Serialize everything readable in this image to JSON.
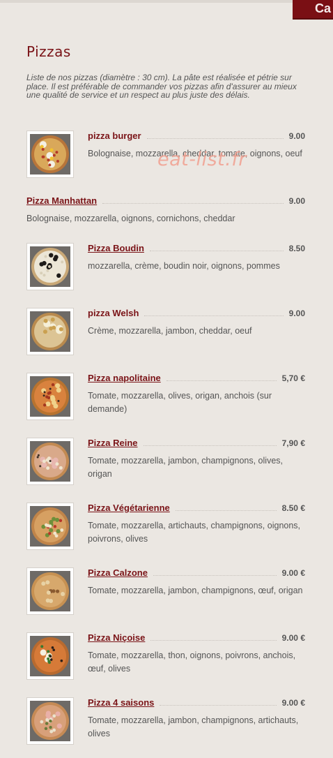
{
  "header": {
    "tab_label": "Ca"
  },
  "page": {
    "title": "Pizzas",
    "intro": "Liste de nos pizzas (diamètre : 30 cm). La pâte est réalisée et pétrie sur place. Il est préférable de commander vos pizzas afin d'assurer au mieux une qualité de service et un respect au plus juste des délais.",
    "watermark": "eat-list.fr"
  },
  "menu": [
    {
      "name": "pizza burger",
      "price": "9.00",
      "description": "Bolognaise, mozzarella, cheddar, tomate, oignons, oeuf",
      "underline": false,
      "has_image": true
    },
    {
      "name": "Pizza Manhattan",
      "price": "9.00",
      "description": "Bolognaise, mozzarella, oignons, cornichons, cheddar",
      "underline": true,
      "has_image": false
    },
    {
      "name": "Pizza Boudin",
      "price": "8.50",
      "description": "mozzarella, crème, boudin noir, oignons, pommes",
      "underline": true,
      "has_image": true
    },
    {
      "name": "pizza Welsh",
      "price": "9.00",
      "description": "Crème, mozzarella, jambon, cheddar, oeuf",
      "underline": false,
      "has_image": true
    },
    {
      "name": "Pizza napolitaine",
      "price": "5,70 €",
      "description": "Tomate, mozzarella, olives, origan, anchois (sur demande)",
      "underline": true,
      "has_image": true
    },
    {
      "name": "Pizza Reine",
      "price": "7,90 €",
      "description": "Tomate, mozzarella, jambon, champignons, olives, origan",
      "underline": true,
      "has_image": true
    },
    {
      "name": "Pizza Végétarienne",
      "price": "8.50 €",
      "description": "Tomate, mozzarella, artichauts, champignons, oignons, poivrons, olives",
      "underline": true,
      "has_image": true
    },
    {
      "name": "Pizza Calzone",
      "price": "9.00 €",
      "description": "Tomate, mozzarella, jambon, champignons, œuf, origan",
      "underline": true,
      "has_image": true
    },
    {
      "name": "Pizza Niçoise",
      "price": "9.00 €",
      "description": "Tomate, mozzarella, thon, oignons, poivrons, anchois, œuf, olives",
      "underline": true,
      "has_image": true
    },
    {
      "name": "Pizza 4 saisons",
      "price": "9.00 €",
      "description": "Tomate, mozzarella, jambon, champignons, artichauts, olives",
      "underline": true,
      "has_image": true
    }
  ],
  "colors": {
    "accent": "#7a1317",
    "background": "#ebe7e2",
    "text": "#555555"
  }
}
